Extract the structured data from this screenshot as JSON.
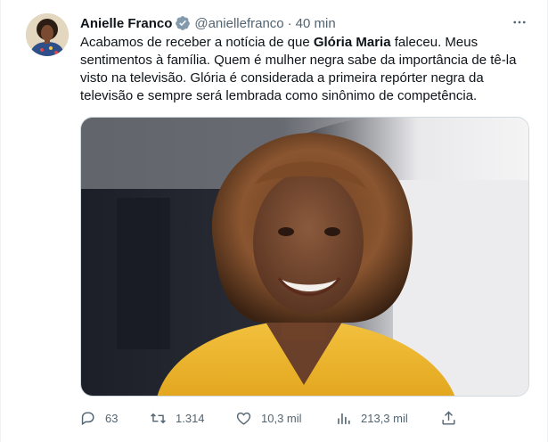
{
  "tweet": {
    "author_name": "Anielle Franco",
    "handle": "@aniellefranco",
    "separator": "·",
    "time": "40 min",
    "text_parts": {
      "p1": "Acabamos de receber a notícia de que ",
      "bold": "Glória Maria",
      "p2": " faleceu. Meus sentimentos à família. Quem é mulher negra sabe da importância de tê-la visto na televisão. Glória é considerada a primeira repórter negra da televisão e sempre será lembrada como sinônimo de competência."
    },
    "actions": {
      "replies": "63",
      "retweets": "1.314",
      "likes": "10,3 mil",
      "views": "213,3 mil"
    }
  },
  "colors": {
    "text": "#0f1419",
    "secondary": "#536471",
    "verified_badge": "#829aab",
    "photo_dress": "#f0b930"
  },
  "icons": [
    "avatar",
    "verified-badge-icon",
    "more-options-icon",
    "reply-icon",
    "retweet-icon",
    "like-icon",
    "views-icon",
    "share-icon"
  ]
}
